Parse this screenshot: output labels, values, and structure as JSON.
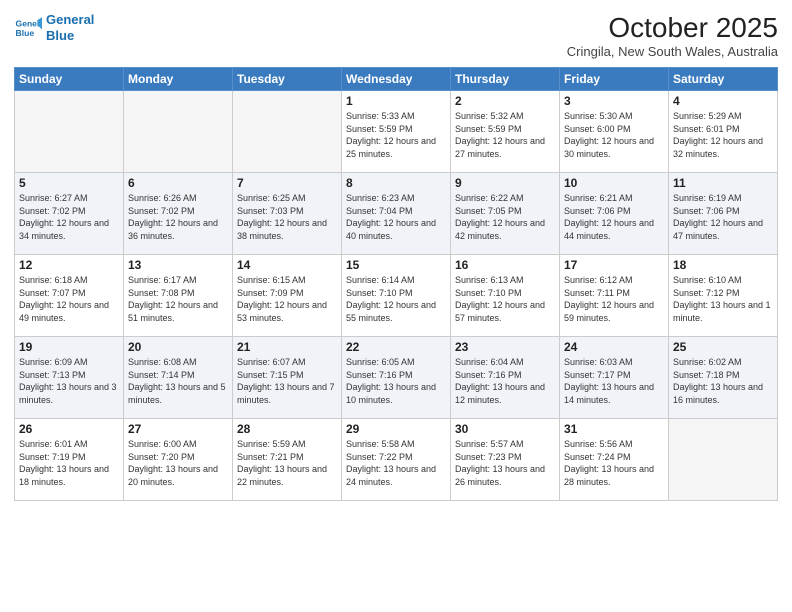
{
  "header": {
    "logo_line1": "General",
    "logo_line2": "Blue",
    "title": "October 2025",
    "location": "Cringila, New South Wales, Australia"
  },
  "weekdays": [
    "Sunday",
    "Monday",
    "Tuesday",
    "Wednesday",
    "Thursday",
    "Friday",
    "Saturday"
  ],
  "weeks": [
    [
      {
        "day": "",
        "info": ""
      },
      {
        "day": "",
        "info": ""
      },
      {
        "day": "",
        "info": ""
      },
      {
        "day": "1",
        "info": "Sunrise: 5:33 AM\nSunset: 5:59 PM\nDaylight: 12 hours\nand 25 minutes."
      },
      {
        "day": "2",
        "info": "Sunrise: 5:32 AM\nSunset: 5:59 PM\nDaylight: 12 hours\nand 27 minutes."
      },
      {
        "day": "3",
        "info": "Sunrise: 5:30 AM\nSunset: 6:00 PM\nDaylight: 12 hours\nand 30 minutes."
      },
      {
        "day": "4",
        "info": "Sunrise: 5:29 AM\nSunset: 6:01 PM\nDaylight: 12 hours\nand 32 minutes."
      }
    ],
    [
      {
        "day": "5",
        "info": "Sunrise: 6:27 AM\nSunset: 7:02 PM\nDaylight: 12 hours\nand 34 minutes."
      },
      {
        "day": "6",
        "info": "Sunrise: 6:26 AM\nSunset: 7:02 PM\nDaylight: 12 hours\nand 36 minutes."
      },
      {
        "day": "7",
        "info": "Sunrise: 6:25 AM\nSunset: 7:03 PM\nDaylight: 12 hours\nand 38 minutes."
      },
      {
        "day": "8",
        "info": "Sunrise: 6:23 AM\nSunset: 7:04 PM\nDaylight: 12 hours\nand 40 minutes."
      },
      {
        "day": "9",
        "info": "Sunrise: 6:22 AM\nSunset: 7:05 PM\nDaylight: 12 hours\nand 42 minutes."
      },
      {
        "day": "10",
        "info": "Sunrise: 6:21 AM\nSunset: 7:06 PM\nDaylight: 12 hours\nand 44 minutes."
      },
      {
        "day": "11",
        "info": "Sunrise: 6:19 AM\nSunset: 7:06 PM\nDaylight: 12 hours\nand 47 minutes."
      }
    ],
    [
      {
        "day": "12",
        "info": "Sunrise: 6:18 AM\nSunset: 7:07 PM\nDaylight: 12 hours\nand 49 minutes."
      },
      {
        "day": "13",
        "info": "Sunrise: 6:17 AM\nSunset: 7:08 PM\nDaylight: 12 hours\nand 51 minutes."
      },
      {
        "day": "14",
        "info": "Sunrise: 6:15 AM\nSunset: 7:09 PM\nDaylight: 12 hours\nand 53 minutes."
      },
      {
        "day": "15",
        "info": "Sunrise: 6:14 AM\nSunset: 7:10 PM\nDaylight: 12 hours\nand 55 minutes."
      },
      {
        "day": "16",
        "info": "Sunrise: 6:13 AM\nSunset: 7:10 PM\nDaylight: 12 hours\nand 57 minutes."
      },
      {
        "day": "17",
        "info": "Sunrise: 6:12 AM\nSunset: 7:11 PM\nDaylight: 12 hours\nand 59 minutes."
      },
      {
        "day": "18",
        "info": "Sunrise: 6:10 AM\nSunset: 7:12 PM\nDaylight: 13 hours\nand 1 minute."
      }
    ],
    [
      {
        "day": "19",
        "info": "Sunrise: 6:09 AM\nSunset: 7:13 PM\nDaylight: 13 hours\nand 3 minutes."
      },
      {
        "day": "20",
        "info": "Sunrise: 6:08 AM\nSunset: 7:14 PM\nDaylight: 13 hours\nand 5 minutes."
      },
      {
        "day": "21",
        "info": "Sunrise: 6:07 AM\nSunset: 7:15 PM\nDaylight: 13 hours\nand 7 minutes."
      },
      {
        "day": "22",
        "info": "Sunrise: 6:05 AM\nSunset: 7:16 PM\nDaylight: 13 hours\nand 10 minutes."
      },
      {
        "day": "23",
        "info": "Sunrise: 6:04 AM\nSunset: 7:16 PM\nDaylight: 13 hours\nand 12 minutes."
      },
      {
        "day": "24",
        "info": "Sunrise: 6:03 AM\nSunset: 7:17 PM\nDaylight: 13 hours\nand 14 minutes."
      },
      {
        "day": "25",
        "info": "Sunrise: 6:02 AM\nSunset: 7:18 PM\nDaylight: 13 hours\nand 16 minutes."
      }
    ],
    [
      {
        "day": "26",
        "info": "Sunrise: 6:01 AM\nSunset: 7:19 PM\nDaylight: 13 hours\nand 18 minutes."
      },
      {
        "day": "27",
        "info": "Sunrise: 6:00 AM\nSunset: 7:20 PM\nDaylight: 13 hours\nand 20 minutes."
      },
      {
        "day": "28",
        "info": "Sunrise: 5:59 AM\nSunset: 7:21 PM\nDaylight: 13 hours\nand 22 minutes."
      },
      {
        "day": "29",
        "info": "Sunrise: 5:58 AM\nSunset: 7:22 PM\nDaylight: 13 hours\nand 24 minutes."
      },
      {
        "day": "30",
        "info": "Sunrise: 5:57 AM\nSunset: 7:23 PM\nDaylight: 13 hours\nand 26 minutes."
      },
      {
        "day": "31",
        "info": "Sunrise: 5:56 AM\nSunset: 7:24 PM\nDaylight: 13 hours\nand 28 minutes."
      },
      {
        "day": "",
        "info": ""
      }
    ]
  ]
}
